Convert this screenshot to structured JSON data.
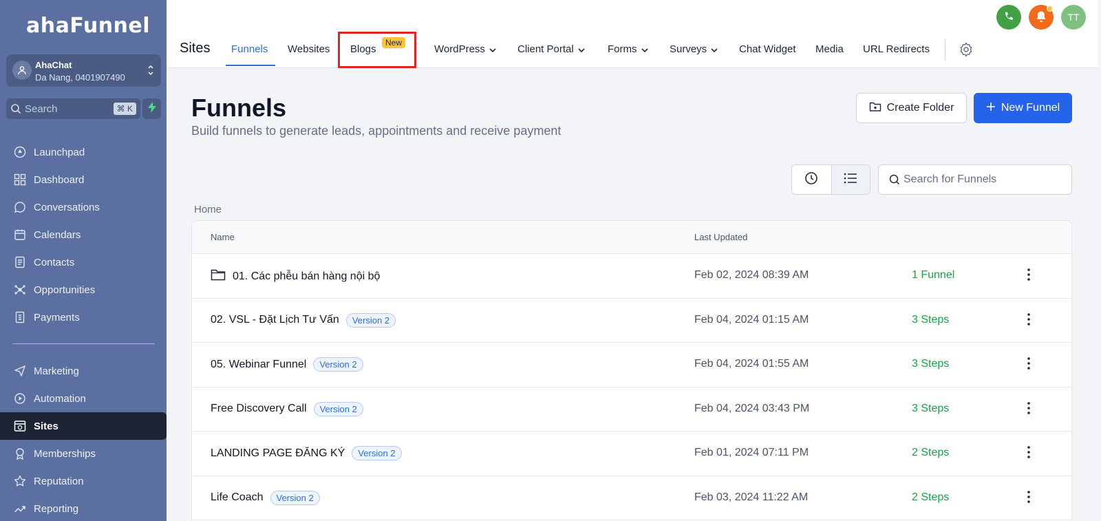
{
  "brand": {
    "logo_text": "ahaFunnel"
  },
  "account": {
    "name": "AhaChat",
    "detail": "Da Nang, 0401907490"
  },
  "sidebar_search": {
    "placeholder": "Search",
    "shortcut": "⌘ K"
  },
  "sidebar": {
    "items_top": [
      {
        "label": "Launchpad",
        "icon": "rocket-icon"
      },
      {
        "label": "Dashboard",
        "icon": "grid-icon"
      },
      {
        "label": "Conversations",
        "icon": "chat-icon"
      },
      {
        "label": "Calendars",
        "icon": "calendar-icon"
      },
      {
        "label": "Contacts",
        "icon": "contacts-icon"
      },
      {
        "label": "Opportunities",
        "icon": "opportunities-icon"
      },
      {
        "label": "Payments",
        "icon": "receipt-icon"
      }
    ],
    "items_bottom": [
      {
        "label": "Marketing",
        "icon": "send-icon"
      },
      {
        "label": "Automation",
        "icon": "automation-icon"
      },
      {
        "label": "Sites",
        "icon": "sites-icon",
        "active": true
      },
      {
        "label": "Memberships",
        "icon": "badge-icon"
      },
      {
        "label": "Reputation",
        "icon": "star-icon"
      },
      {
        "label": "Reporting",
        "icon": "chart-icon"
      }
    ]
  },
  "topbar": {
    "title": "Sites",
    "tabs": [
      {
        "label": "Funnels",
        "active": true
      },
      {
        "label": "Websites"
      },
      {
        "label": "Blogs",
        "badge": "New"
      },
      {
        "label": "WordPress",
        "dropdown": true
      },
      {
        "label": "Client Portal",
        "dropdown": true
      },
      {
        "label": "Forms",
        "dropdown": true
      },
      {
        "label": "Surveys",
        "dropdown": true
      },
      {
        "label": "Chat Widget"
      },
      {
        "label": "Media"
      },
      {
        "label": "URL Redirects"
      }
    ],
    "avatar_initials": "TT"
  },
  "colors": {
    "sidebar": "#5b6fa0",
    "accent": "#2563eb",
    "success": "#16a34a",
    "highlight": "#e02424"
  },
  "main": {
    "title": "Funnels",
    "subtitle": "Build funnels to generate leads, appointments and receive payment",
    "create_folder": "Create Folder",
    "new_funnel": "New Funnel",
    "search_placeholder": "Search for Funnels",
    "breadcrumb": "Home",
    "columns": {
      "name": "Name",
      "updated": "Last Updated"
    },
    "rows": [
      {
        "name": "01. Các phễu bán hàng nội bộ",
        "folder": true,
        "updated": "Feb 02, 2024 08:39 AM",
        "status": "1 Funnel"
      },
      {
        "name": "02. VSL - Đặt Lịch Tư Vấn",
        "version": "Version 2",
        "updated": "Feb 04, 2024 01:15 AM",
        "status": "3 Steps"
      },
      {
        "name": "05. Webinar Funnel",
        "version": "Version 2",
        "updated": "Feb 04, 2024 01:55 AM",
        "status": "3 Steps"
      },
      {
        "name": "Free Discovery Call",
        "version": "Version 2",
        "updated": "Feb 04, 2024 03:43 PM",
        "status": "3 Steps"
      },
      {
        "name": "LANDING PAGE ĐĂNG KÝ",
        "version": "Version 2",
        "updated": "Feb 01, 2024 07:11 PM",
        "status": "2 Steps"
      },
      {
        "name": "Life Coach",
        "version": "Version 2",
        "updated": "Feb 03, 2024 11:22 AM",
        "status": "2 Steps"
      }
    ]
  }
}
